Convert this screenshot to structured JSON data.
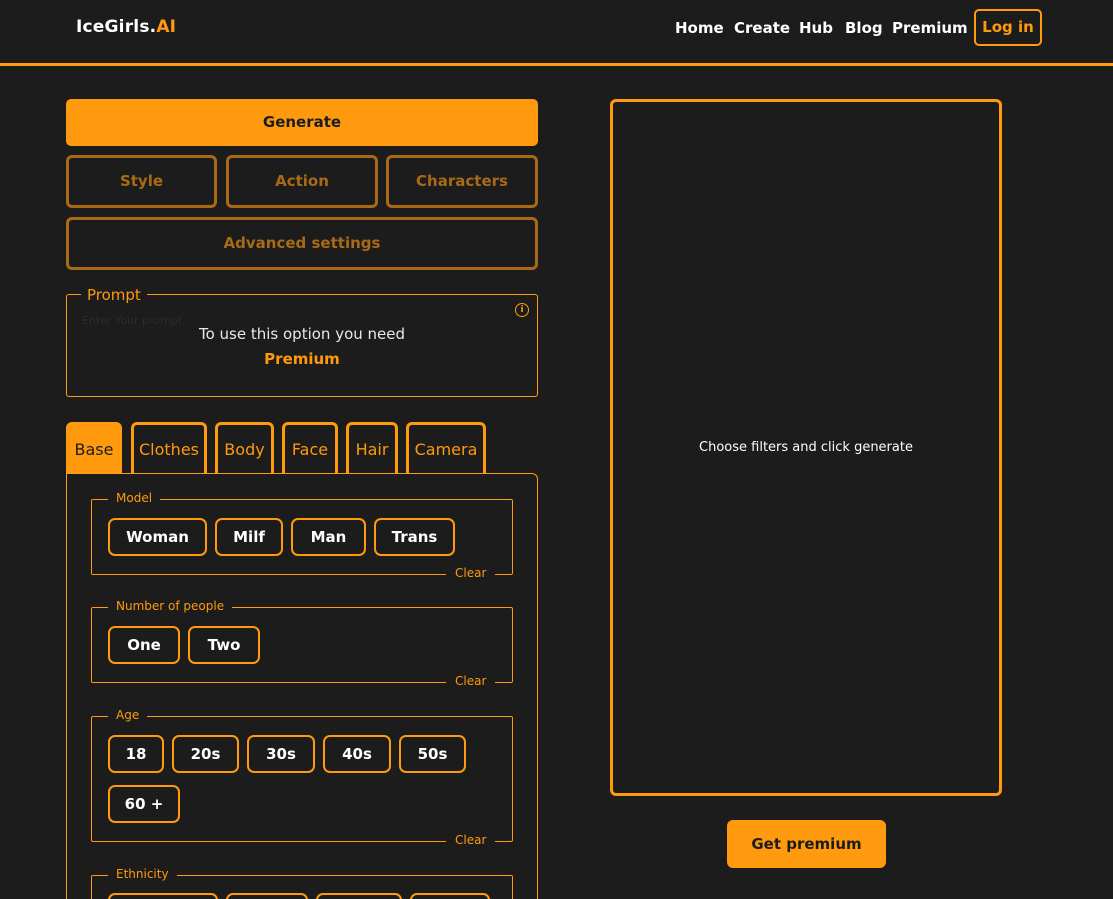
{
  "header": {
    "logo_main": "IceGirls.",
    "logo_accent": "AI",
    "nav": [
      "Home",
      "Create",
      "Hub",
      "Blog",
      "Premium"
    ],
    "login": "Log in"
  },
  "controls": {
    "generate": "Generate",
    "style": "Style",
    "action": "Action",
    "characters": "Characters",
    "advanced": "Advanced settings"
  },
  "prompt": {
    "legend": "Prompt",
    "placeholder": "Enter Your prompt",
    "info_icon": "i",
    "message": "To use this option you need",
    "premium": "Premium"
  },
  "tabs": [
    "Base",
    "Clothes",
    "Body",
    "Face",
    "Hair",
    "Camera"
  ],
  "filters": {
    "model": {
      "label": "Model",
      "options": [
        "Woman",
        "Milf",
        "Man",
        "Trans"
      ],
      "clear": "Clear"
    },
    "people": {
      "label": "Number of people",
      "options": [
        "One",
        "Two"
      ],
      "clear": "Clear"
    },
    "age": {
      "label": "Age",
      "options": [
        "18",
        "20s",
        "30s",
        "40s",
        "50s",
        "60 +"
      ],
      "clear": "Clear"
    },
    "ethnicity": {
      "label": "Ethnicity"
    }
  },
  "preview": {
    "text": "Choose filters and click generate",
    "button": "Get premium"
  },
  "colors": {
    "accent": "#ff9a0e",
    "background": "#1c1c1c",
    "muted_accent": "#a86a14"
  }
}
